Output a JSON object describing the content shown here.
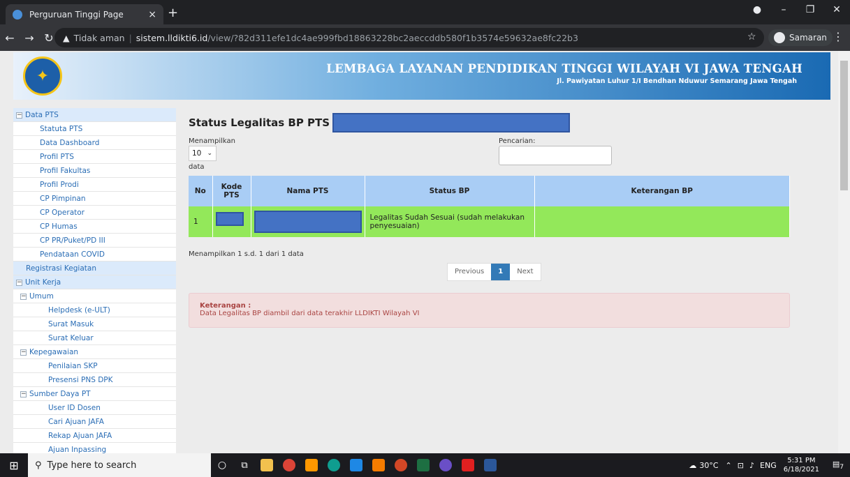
{
  "browser": {
    "tab_title": "Perguruan Tinggi Page",
    "tab_close": "×",
    "new_tab": "+",
    "address_warning": "Tidak aman",
    "address_host": "sistem.lldikti6.id",
    "address_path": "/view/?82d311efe1dc4ae999fbd18863228bc2aeccddb580f1b3574e59632ae8fc22b3",
    "profile_label": "Samaran"
  },
  "header": {
    "institution_name": "LEMBAGA LAYANAN PENDIDIKAN TINGGI WILAYAH VI JAWA TENGAH",
    "address": "Jl. Pawiyatan Luhur 1/I Bendhan Nduwur Semarang Jawa Tengah"
  },
  "sidebar": {
    "data_pts": "Data PTS",
    "data_pts_items": [
      "Statuta PTS",
      "Data Dashboard",
      "Profil PTS",
      "Profil Fakultas",
      "Profil Prodi",
      "CP Pimpinan",
      "CP Operator",
      "CP Humas",
      "CP PR/Puket/PD III",
      "Pendataan COVID"
    ],
    "registrasi": "Registrasi Kegiatan",
    "unit_kerja": "Unit Kerja",
    "umum": "Umum",
    "umum_items": [
      "Helpdesk (e-ULT)",
      "Surat Masuk",
      "Surat Keluar"
    ],
    "kepegawaian": "Kepegawaian",
    "kepegawaian_items": [
      "Penilaian SKP",
      "Presensi PNS DPK"
    ],
    "sdpt": "Sumber Daya PT",
    "sdpt_items": [
      "User ID Dosen",
      "Cari Ajuan JAFA",
      "Rekap Ajuan JAFA",
      "Ajuan Inpassing"
    ]
  },
  "main": {
    "title": "Status Legalitas BP PTS",
    "length_label": "Menampilkan",
    "length_value": "10",
    "length_suffix": "data",
    "search_label": "Pencarian:",
    "columns": [
      "No",
      "Kode PTS",
      "Nama PTS",
      "Status BP",
      "Keterangan BP"
    ],
    "rows": [
      {
        "no": "1",
        "status": "Legalitas Sudah Sesuai (sudah melakukan penyesuaian)",
        "keterangan": ""
      }
    ],
    "info": "Menampilkan 1 s.d. 1 dari 1 data",
    "pagination": {
      "previous": "Previous",
      "current": "1",
      "next": "Next"
    },
    "alert_title": "Keterangan :",
    "alert_text": "Data Legalitas BP diambil dari data terakhir LLDIKTI Wilayah VI"
  },
  "taskbar": {
    "search_placeholder": "Type here to search",
    "weather": "30°C",
    "language": "ENG",
    "time": "5:31 PM",
    "date": "6/18/2021",
    "notifications": "7"
  },
  "colors": {
    "table_header": "#a9cdf5",
    "row_success": "#93e85a",
    "redaction": "#4472c4",
    "alert_bg": "#f2dede"
  }
}
